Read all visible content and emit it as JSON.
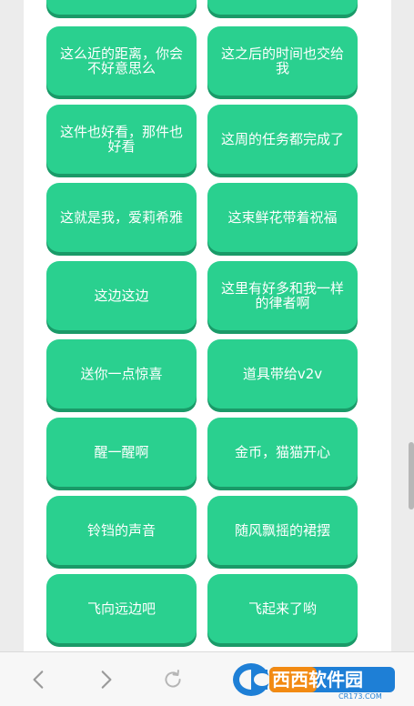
{
  "buttons": [
    {
      "label": ""
    },
    {
      "label": ""
    },
    {
      "label": "这么近的距离，你会不好意思么"
    },
    {
      "label": "这之后的时间也交给我"
    },
    {
      "label": "这件也好看，那件也好看"
    },
    {
      "label": "这周的任务都完成了"
    },
    {
      "label": "这就是我，爱莉希雅"
    },
    {
      "label": "这束鲜花带着祝福"
    },
    {
      "label": "这边这边"
    },
    {
      "label": "这里有好多和我一样的律者啊"
    },
    {
      "label": "送你一点惊喜"
    },
    {
      "label": "道具带给v2v"
    },
    {
      "label": "醒一醒啊"
    },
    {
      "label": "金币，猫猫开心"
    },
    {
      "label": "铃铛的声音"
    },
    {
      "label": "随风飘摇的裙摆"
    },
    {
      "label": "飞向远边吧"
    },
    {
      "label": "飞起来了哟"
    }
  ],
  "nav": {
    "back_icon": "chevron-left-icon",
    "forward_icon": "chevron-right-icon",
    "refresh_icon": "refresh-icon"
  },
  "watermark": {
    "brand_text": "西西软件园",
    "domain_text": "CR173.COM"
  },
  "colors": {
    "button": "#2ad08f",
    "button_shadow": "#1a9a68",
    "page_bg": "#ffffff",
    "outer_bg": "#ececec"
  }
}
